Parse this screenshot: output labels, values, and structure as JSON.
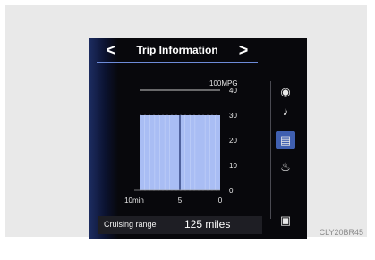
{
  "screen": {
    "title": "Trip Information",
    "prev_arrow": "<",
    "next_arrow": ">"
  },
  "chart_data": {
    "type": "bar",
    "unit_label": "100MPG",
    "y_ticks": [
      "40",
      "30",
      "20",
      "10",
      "0"
    ],
    "x_ticks": [
      "10min",
      "5",
      "0"
    ],
    "ylim": [
      0,
      40
    ],
    "xlim": [
      10,
      0
    ],
    "bars": [
      {
        "value": 30
      },
      {
        "value": 30
      }
    ],
    "bar_color": "#a9bdf4",
    "grid": true
  },
  "side_menu": [
    {
      "icon": "navigation-icon",
      "glyph": "◉",
      "selected": false
    },
    {
      "icon": "music-note-icon",
      "glyph": "♪",
      "selected": false
    },
    {
      "icon": "trip-information-icon",
      "glyph": "▤",
      "selected": true
    },
    {
      "icon": "climate-icon",
      "glyph": "♨",
      "selected": false
    },
    {
      "icon": "display-off-icon",
      "glyph": "▣",
      "selected": false
    }
  ],
  "cruising_range": {
    "label": "Cruising range",
    "value": "125 miles"
  },
  "image_code": "CLY20BR45"
}
